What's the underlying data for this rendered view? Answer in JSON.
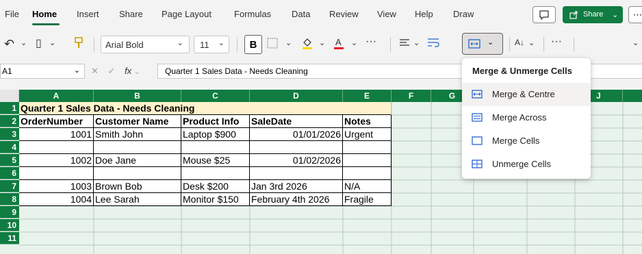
{
  "menu": {
    "tabs": [
      "File",
      "Home",
      "Insert",
      "Share",
      "Page Layout",
      "Formulas",
      "Data",
      "Review",
      "View",
      "Help",
      "Draw"
    ],
    "active_tab": "Home",
    "share_label": "Share",
    "more": "⋯"
  },
  "ribbon": {
    "font_name": "Arial Bold",
    "font_size": "11",
    "bold": "B",
    "undo": "↶",
    "paste": "▯",
    "format_painter": "🖌",
    "more": "···",
    "sort": "A↓"
  },
  "formula_bar": {
    "name_box": "A1",
    "fx": "fx",
    "content": "Quarter 1 Sales Data - Needs Cleaning"
  },
  "grid": {
    "columns": [
      "A",
      "B",
      "C",
      "D",
      "E",
      "F",
      "G",
      "H",
      "I",
      "J"
    ],
    "rows": [
      "1",
      "2",
      "3",
      "4",
      "5",
      "6",
      "7",
      "8",
      "9",
      "10",
      "11"
    ],
    "cells": {
      "A1": "Quarter 1 Sales Data - Needs Cleaning",
      "A2": "OrderNumber",
      "B2": "Customer Name",
      "C2": "Product Info",
      "D2": "SaleDate",
      "E2": "Notes",
      "A3": "1001",
      "B3": "Smith John",
      "C3": "Laptop $900",
      "D3": "01/01/2026",
      "E3": "Urgent",
      "A5": "1002",
      "B5": "Doe Jane",
      "C5": "Mouse $25",
      "D5": "01/02/2026",
      "A7": "1003",
      "B7": "Brown Bob",
      "C7": "Desk $200",
      "D7": "Jan 3rd 2026",
      "E7": "N/A",
      "A8": "1004",
      "B8": "Lee Sarah",
      "C8": "Monitor $150",
      "D8": "February 4th 2026",
      "E8": "Fragile"
    }
  },
  "dropdown": {
    "title": "Merge & Unmerge Cells",
    "items": [
      {
        "label": "Merge & Centre",
        "icon": "merge-centre-icon"
      },
      {
        "label": "Merge Across",
        "icon": "merge-across-icon"
      },
      {
        "label": "Merge Cells",
        "icon": "merge-cells-icon"
      },
      {
        "label": "Unmerge Cells",
        "icon": "unmerge-cells-icon"
      }
    ]
  },
  "colors": {
    "accent": "#107c41",
    "title_fill": "#fff2cc",
    "sheet_bg": "#e8f3ec"
  }
}
